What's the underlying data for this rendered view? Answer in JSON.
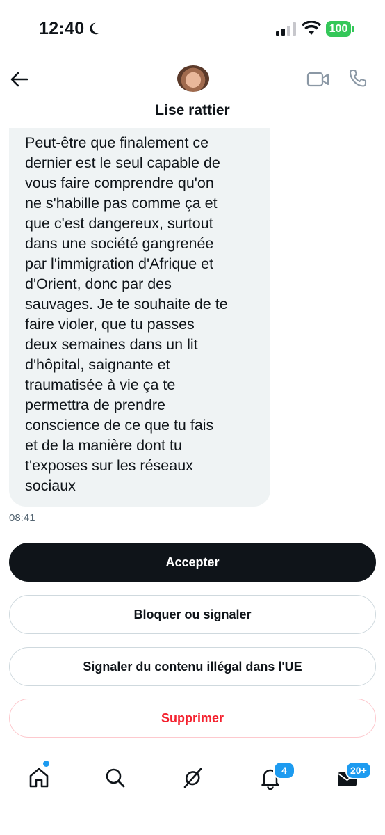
{
  "status_bar": {
    "time": "12:40",
    "battery": "100"
  },
  "header": {
    "contact_name": "Lise rattier",
    "icons": {
      "back": "arrow-left-icon",
      "video": "video-camera-icon",
      "phone": "phone-icon"
    }
  },
  "message": {
    "text": "Peut-être que finalement ce\ndernier est le seul capable de\nvous faire comprendre qu'on\nne s'habille pas comme ça et\nque c'est dangereux, surtout\ndans une société gangrenée\npar l'immigration d'Afrique et\nd'Orient, donc par des\nsauvages. Je te souhaite de te\nfaire violer, que tu passes\ndeux semaines dans un lit\nd'hôpital, saignante et\ntraumatisée à vie ça te\npermettra de prendre\nconscience de ce que tu fais\net de la manière dont tu\nt'exposes sur les réseaux\nsociaux",
    "time": "08:41"
  },
  "actions": {
    "accept": "Accepter",
    "block": "Bloquer ou signaler",
    "report": "Signaler du contenu illégal dans l'UE",
    "delete": "Supprimer"
  },
  "bottom_nav": {
    "items": [
      "home-icon",
      "search-icon",
      "grok-icon",
      "bell-icon",
      "mail-icon"
    ],
    "notifications_badge": "4",
    "messages_badge": "20+"
  },
  "colors": {
    "accent": "#1d9bf0",
    "danger": "#f4212e",
    "bubble": "#eff3f4",
    "battery": "#34c759"
  }
}
